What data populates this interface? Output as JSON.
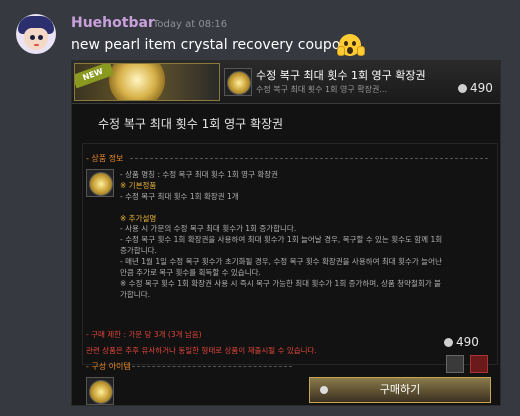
{
  "message": {
    "username": "Huehotbar",
    "timestamp": "Today at 08:16",
    "text": "new pearl item crystal recovery coupon",
    "emoji": "screaming-face-emoji"
  },
  "game": {
    "new_tag": "NEW",
    "item_title": "수정 복구 최대 횟수 1회 영구 확장권",
    "item_subtitle": "수정 복구 최대 횟수 1회 영구 확장권...",
    "price": "490",
    "detail_title": "수정 복구 최대 횟수 1회 영구 확장권",
    "product_info_label": "- 상품 정보",
    "info_lines": [
      "- 상품 명칭 : 수정 복구 최대 횟수 1회 영구 확장권",
      "※ 기본정품",
      "- 수정 복구 최대 횟수 1회 확장권 1개"
    ],
    "additional_label": "※ 추가설명",
    "additional_lines": [
      "- 사용 시 가문의 수정 복구 최대 횟수가 1회 증가합니다.",
      "- 수정 복구 횟수 1회 확장권을 사용하여 최대 횟수가 1회 늘어날 경우, 복구할 수 있는 횟수도 함께 1회",
      "증가합니다.",
      "- 매년 1월 1일 수정 복구 횟수가 초기화될 경우, 수정 복구 횟수 확장권을 사용하여 최대 횟수가 늘어난",
      "만큼 추가로 복구 횟수를 획득할 수 있습니다.",
      "※ 수정 복구 횟수 1회 확장권 사용 시 즉시 복구 가능한 최대 횟수가 1회 증가하며, 상품 청약철회가 불",
      "가합니다."
    ],
    "purchase_limit": "- 구매 제한 : 가문 당 3개 (3개 남음)",
    "legal_notice": "관련 상품은 추후 유사하거나 동일한 형태로 상품이 재출시될 수 있습니다.",
    "bottom_price": "490",
    "composition_label": "- 구성 아이템",
    "buy_label": "구매하기"
  },
  "colors": {
    "background": "#36393f",
    "username": "#c9a0dc",
    "accent_orange": "#e88a2a",
    "accent_red": "#e0463a",
    "gold": "#c9a650"
  }
}
